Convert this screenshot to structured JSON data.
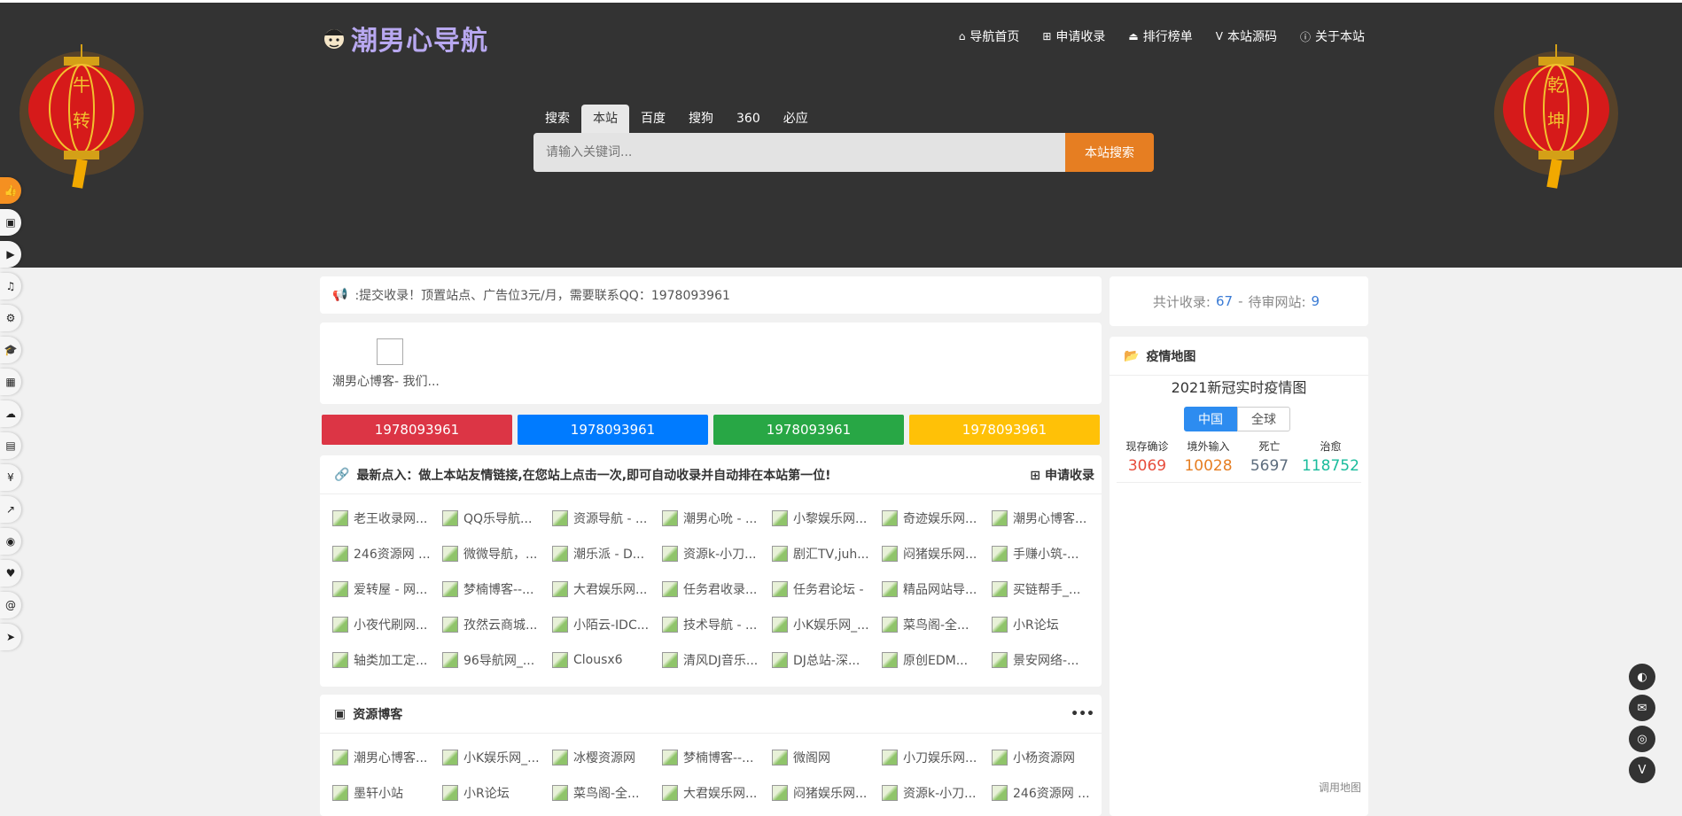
{
  "header": {
    "logo_text": "潮男心导航",
    "nav": [
      {
        "icon": "home-icon",
        "glyph": "⌂",
        "label": "导航首页"
      },
      {
        "icon": "plus-square-icon",
        "glyph": "⊞",
        "label": "申请收录"
      },
      {
        "icon": "ranking-icon",
        "glyph": "⏏",
        "label": "排行榜单"
      },
      {
        "icon": "vimeo-icon",
        "glyph": "V",
        "label": "本站源码"
      },
      {
        "icon": "info-icon",
        "glyph": "ⓘ",
        "label": "关于本站"
      }
    ],
    "lantern_left_chars": [
      "牛",
      "转"
    ],
    "lantern_right_chars": [
      "乾",
      "坤"
    ]
  },
  "search": {
    "tabs": [
      "搜索",
      "本站",
      "百度",
      "搜狗",
      "360",
      "必应"
    ],
    "active_tab": "本站",
    "placeholder": "请输入关键词...",
    "button": "本站搜索"
  },
  "sidebar_icons": [
    "thumbs-up-icon",
    "gamepad-icon",
    "youtube-icon",
    "music-icon",
    "network-icon",
    "graduation-cap-icon",
    "grid-icon",
    "cloud-icon",
    "document-icon",
    "yen-icon",
    "chart-icon",
    "compass-icon",
    "heartbeat-icon",
    "spiral-icon",
    "send-icon"
  ],
  "notice": {
    "text": ":提交收录！顶置站点、广告位3元/月，需要联系QQ：1978093961"
  },
  "profile": {
    "name": "潮男心博客- 我们..."
  },
  "qq_buttons": [
    {
      "label": "1978093961",
      "color": "#dc3545"
    },
    {
      "label": "1978093961",
      "color": "#007bff"
    },
    {
      "label": "1978093961",
      "color": "#28a745"
    },
    {
      "label": "1978093961",
      "color": "#ffc107"
    }
  ],
  "latest": {
    "title": "最新点入：做上本站友情链接,在您站上点击一次,即可自动收录并自动排在本站第一位!",
    "right_label": "申请收录",
    "links": [
      "老王收录网...",
      "QQ乐导航...",
      "资源导航 - ...",
      "潮男心吮 - ...",
      "小黎娱乐网...",
      "奇迹娱乐网...",
      "潮男心博客...",
      "246资源网 ...",
      "微微导航，...",
      "潮乐派 - D...",
      "资源k-小刀...",
      "剧汇TV,juh...",
      "闷猪娱乐网...",
      "手赚小筑-...",
      "爱转屋 - 网...",
      "梦楠博客--...",
      "大君娱乐网...",
      "任务君收录...",
      "任务君论坛 -",
      "精品网站导...",
      "买链帮手_...",
      "小夜代刷网...",
      "孜然云商城...",
      "小陌云-IDC...",
      "技术导航 - ...",
      "小K娱乐网_...",
      "菜鸟阁-全...",
      "小R论坛",
      "轴类加工定...",
      "96导航网_...",
      "Clousx6",
      "清风DJ音乐...",
      "DJ总站-深...",
      "原创EDM...",
      "景安网络-..."
    ]
  },
  "blog": {
    "title": "资源博客",
    "more": "•••",
    "links": [
      "潮男心博客...",
      "小K娱乐网_...",
      "冰樱资源网",
      "梦楠博客--...",
      "微阁网",
      "小刀娱乐网...",
      "小杨资源网",
      "墨轩小站",
      "小R论坛",
      "菜鸟阁-全...",
      "大君娱乐网...",
      "闷猪娱乐网...",
      "资源k-小刀...",
      "246资源网 ..."
    ]
  },
  "stats": {
    "label1": "共计收录:",
    "count": "67",
    "sep": "-",
    "label2": "待审网站:",
    "pending": "9"
  },
  "covid": {
    "header": "疫情地图",
    "title": "2021新冠实时疫情图",
    "tab_cn": "中国",
    "tab_global": "全球",
    "items": [
      {
        "label": "现存确诊",
        "value": "3069",
        "color": "#e74c3c"
      },
      {
        "label": "境外输入",
        "value": "10028",
        "color": "#e67e22"
      },
      {
        "label": "死亡",
        "value": "5697",
        "color": "#5d6d7e"
      },
      {
        "label": "治愈",
        "value": "118752",
        "color": "#1abc9c"
      }
    ],
    "footer": "调用地图"
  },
  "floating": [
    "qq-icon",
    "mail-icon",
    "wechat-icon",
    "vimeo-icon"
  ]
}
